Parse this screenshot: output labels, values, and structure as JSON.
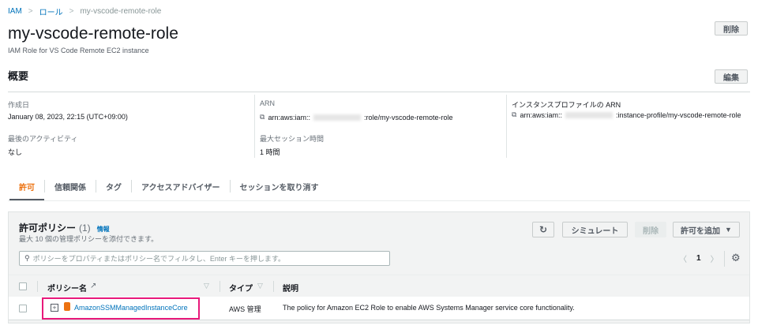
{
  "breadcrumb": {
    "items": [
      "IAM",
      "ロール"
    ],
    "current": "my-vscode-remote-role"
  },
  "header": {
    "title": "my-vscode-remote-role",
    "description": "IAM Role for VS Code Remote EC2 instance",
    "delete_label": "削除"
  },
  "summary": {
    "title": "概要",
    "edit_label": "編集",
    "created_label": "作成日",
    "created_value": "January 08, 2023, 22:15 (UTC+09:00)",
    "last_activity_label": "最後のアクティビティ",
    "last_activity_value": "なし",
    "arn_label": "ARN",
    "arn_prefix": "arn:aws:iam::",
    "arn_suffix": ":role/my-vscode-remote-role",
    "max_session_label": "最大セッション時間",
    "max_session_value": "1 時間",
    "instance_profile_label": "インスタンスプロファイルの ARN",
    "instance_profile_prefix": "arn:aws:iam::",
    "instance_profile_suffix": ":instance-profile/my-vscode-remote-role"
  },
  "tabs": [
    "許可",
    "信頼関係",
    "タグ",
    "アクセスアドバイザー",
    "セッションを取り消す"
  ],
  "policies": {
    "title": "許可ポリシー",
    "count": "(1)",
    "info": "情報",
    "subtitle": "最大 10 個の管理ポリシーを添付できます。",
    "simulate_label": "シミュレート",
    "delete_label": "削除",
    "add_label": "許可を追加",
    "search_placeholder": "ポリシーをプロパティまたはポリシー名でフィルタし、Enter キーを押します。",
    "page": "1",
    "columns": [
      "ポリシー名",
      "タイプ",
      "説明"
    ],
    "rows": [
      {
        "name": "AmazonSSMManagedInstanceCore",
        "type": "AWS 管理",
        "description": "The policy for Amazon EC2 Role to enable AWS Systems Manager service core functionality."
      }
    ]
  },
  "colors": {
    "link": "#0073bb",
    "accent": "#ec7211",
    "highlight": "#e8197a"
  }
}
